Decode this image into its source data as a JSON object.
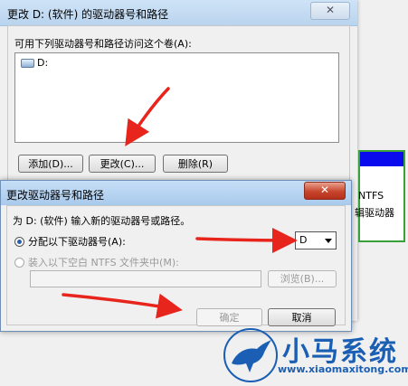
{
  "bg_dialog": {
    "title": "更改 D: (软件) 的驱动器号和路径",
    "access_label": "可用下列驱动器号和路径访问这个卷(A):",
    "list_items": [
      "D:"
    ],
    "add_button": "添加(D)...",
    "change_button": "更改(C)...",
    "delete_button": "删除(R)"
  },
  "disk_mgmt_fragment": {
    "text1": "NTFS",
    "text2": "辑驱动器"
  },
  "fg_dialog": {
    "title": "更改驱动器号和路径",
    "close_glyph": "✕",
    "prompt": "为 D: (软件) 输入新的驱动器号或路径。",
    "radio_assign_label": "分配以下驱动器号(A):",
    "drive_letter_value": "D",
    "radio_mount_label": "装入以下空白 NTFS 文件夹中(M):",
    "path_value": "",
    "browse_button": "浏览(B)...",
    "ok_button": "确定",
    "cancel_button": "取消"
  },
  "watermark": {
    "brand": "小马系统",
    "url": "www.xiaomaxitong.com"
  },
  "colors": {
    "arrow_red": "#e8251c",
    "watermark_blue": "#1a5fb4"
  }
}
